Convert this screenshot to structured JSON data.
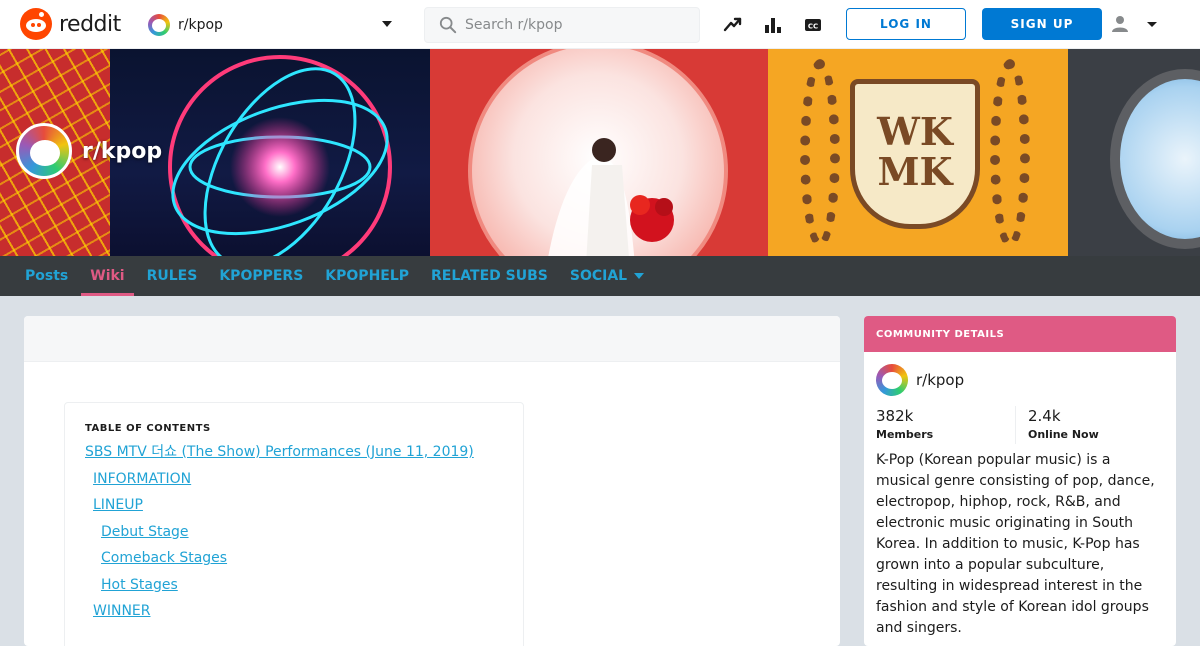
{
  "header": {
    "wordmark": "reddit",
    "subreddit_selector": "r/kpop",
    "search_placeholder": "Search r/kpop",
    "login_label": "LOG IN",
    "signup_label": "SIGN UP",
    "icons": [
      "trending-icon",
      "leaderboard-icon",
      "closed-caption-icon",
      "user-icon",
      "chevron-down-icon"
    ]
  },
  "banner": {
    "title": "r/kpop",
    "crest_text": "WK MK"
  },
  "subnav": {
    "items": [
      {
        "label": "Posts",
        "active": false
      },
      {
        "label": "Wiki",
        "active": true
      },
      {
        "label": "RULES",
        "active": false
      },
      {
        "label": "KPOPPERS",
        "active": false
      },
      {
        "label": "KPOPHELP",
        "active": false
      },
      {
        "label": "RELATED SUBS",
        "active": false
      },
      {
        "label": "SOCIAL",
        "active": false,
        "has_dropdown": true
      }
    ]
  },
  "wiki": {
    "toc_title": "TABLE OF CONTENTS",
    "toc": [
      {
        "label": "SBS MTV 더쇼 (The Show) Performances (June 11, 2019)",
        "level": 1
      },
      {
        "label": "INFORMATION",
        "level": 2
      },
      {
        "label": "LINEUP",
        "level": 2
      },
      {
        "label": "Debut Stage",
        "level": 3
      },
      {
        "label": "Comeback Stages",
        "level": 3
      },
      {
        "label": "Hot Stages",
        "level": 3
      },
      {
        "label": "WINNER",
        "level": 2
      }
    ]
  },
  "sidebar": {
    "header": "COMMUNITY DETAILS",
    "subreddit": "r/kpop",
    "members_count": "382k",
    "members_label": "Members",
    "online_count": "2.4k",
    "online_label": "Online Now",
    "description": "K-Pop (Korean popular music) is a musical genre consisting of pop, dance, electropop, hiphop, rock, R&B, and electronic music originating in South Korea. In addition to music, K-Pop has grown into a popular subculture, resulting in widespread interest in the fashion and style of Korean idol groups and singers."
  },
  "colors": {
    "brand_orange": "#ff4500",
    "accent_blue": "#0079d3",
    "nav_link": "#21a3d5",
    "active_pink": "#df5a84",
    "nav_bg": "#373c3f"
  }
}
